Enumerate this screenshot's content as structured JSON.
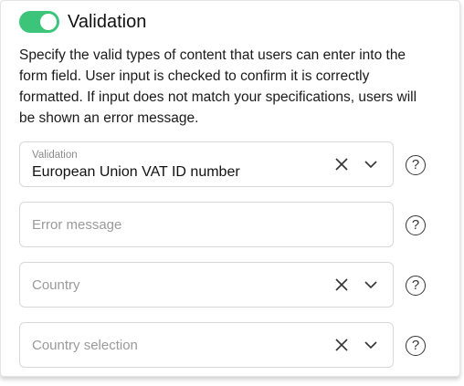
{
  "section": {
    "title": "Validation",
    "enabled": true,
    "toggle_color": "#3cc47a",
    "description": "Specify the valid types of content that users can enter into the form field. User input is checked to confirm it is correctly formatted. If input does not match your specifications, users will be shown an error message."
  },
  "fields": {
    "validation": {
      "label": "Validation",
      "value": "European Union VAT ID number"
    },
    "error_message": {
      "placeholder": "Error message"
    },
    "country": {
      "placeholder": "Country"
    },
    "country_selection": {
      "placeholder": "Country selection"
    }
  },
  "help": {
    "glyph": "?"
  },
  "icons": [
    "toggle-switch",
    "clear-icon",
    "chevron-down-icon",
    "help-icon"
  ]
}
